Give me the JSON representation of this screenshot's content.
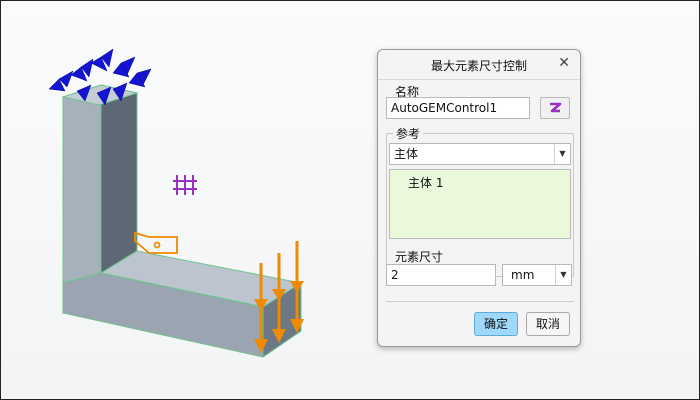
{
  "dialog": {
    "title": "最大元素尺寸控制",
    "close_label": "✕",
    "name_group": {
      "legend": "名称",
      "value": "AutoGEMControl1"
    },
    "reference_group": {
      "legend": "参考",
      "selected": "主体",
      "items": [
        "主体 1"
      ]
    },
    "element_size_group": {
      "legend": "元素尺寸",
      "value": "2",
      "unit": "mm"
    },
    "buttons": {
      "ok": "确定",
      "cancel": "取消"
    }
  },
  "colors": {
    "accent_button": "#9fd8fb",
    "list_bg": "#eaf9dc",
    "constraint_blue": "#1010c8",
    "load_orange": "#f08a00",
    "control_purple": "#9a2fc0",
    "part_gray": "#98a4b0"
  },
  "icons": [
    "constraint-icon",
    "mesh-control-icon",
    "tag-icon",
    "load-arrow-icon",
    "select-reference-icon"
  ]
}
